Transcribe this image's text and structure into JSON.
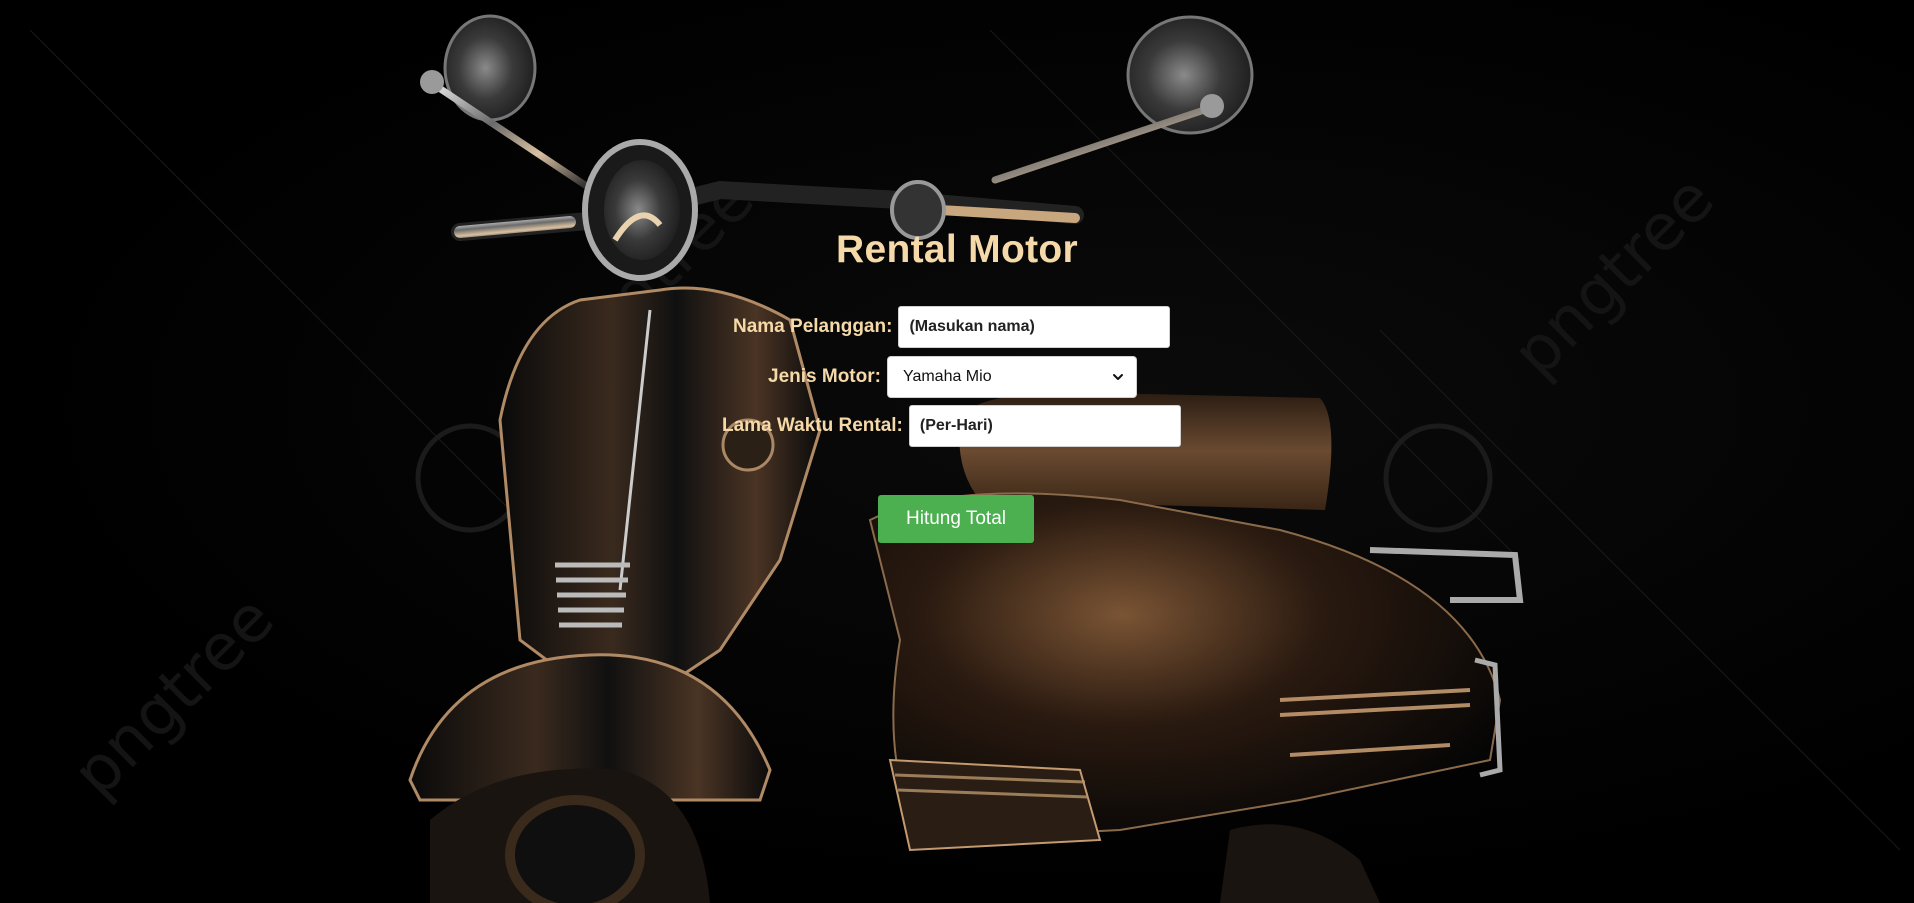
{
  "page": {
    "title": "Rental Motor"
  },
  "form": {
    "nama_label": "Nama Pelanggan:",
    "nama_placeholder": "(Masukan nama)",
    "jenis_label": "Jenis Motor:",
    "jenis_selected": "Yamaha Mio",
    "lama_label": "Lama Waktu Rental:",
    "lama_placeholder": "(Per-Hari)",
    "submit_label": "Hitung Total"
  },
  "background": {
    "subject": "vintage black scooter",
    "watermark": "pngtree"
  },
  "colors": {
    "text_accent": "#f6d9a8",
    "button": "#4caf50",
    "background": "#000000"
  }
}
